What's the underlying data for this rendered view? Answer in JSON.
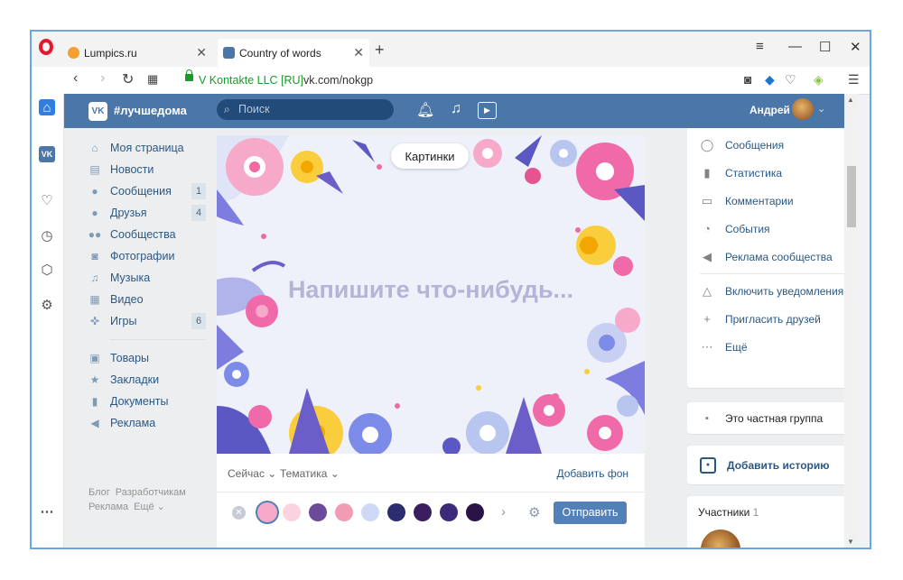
{
  "browser": {
    "tabs": [
      {
        "title": "Lumpics.ru",
        "favicon_color": "#f4a030"
      },
      {
        "title": "Country of words",
        "favicon_color": "#4a76a8"
      }
    ],
    "security_label": "V Kontakte LLC [RU]",
    "url": "vk.com/nokgp"
  },
  "vk": {
    "header": {
      "logo": "VK",
      "hashtag": "#лучшедома",
      "search_placeholder": "Поиск",
      "user_name": "Андрей"
    },
    "left_menu": [
      {
        "label": "Моя страница",
        "icon": "home-icon",
        "count": ""
      },
      {
        "label": "Новости",
        "icon": "news-icon",
        "count": ""
      },
      {
        "label": "Сообщения",
        "icon": "message-icon",
        "count": "1"
      },
      {
        "label": "Друзья",
        "icon": "user-icon",
        "count": "4"
      },
      {
        "label": "Сообщества",
        "icon": "group-icon",
        "count": ""
      },
      {
        "label": "Фотографии",
        "icon": "camera-icon",
        "count": ""
      },
      {
        "label": "Музыка",
        "icon": "music-icon",
        "count": ""
      },
      {
        "label": "Видео",
        "icon": "video-icon",
        "count": ""
      },
      {
        "label": "Игры",
        "icon": "gamepad-icon",
        "count": "6"
      }
    ],
    "left_menu_2": [
      {
        "label": "Товары",
        "icon": "bag-icon"
      },
      {
        "label": "Закладки",
        "icon": "star-icon"
      },
      {
        "label": "Документы",
        "icon": "document-icon"
      },
      {
        "label": "Реклама",
        "icon": "megaphone-icon"
      }
    ],
    "footer_links": [
      "Блог",
      "Разработчикам",
      "Реклама",
      "Ещё ⌄"
    ],
    "post": {
      "gallery_button": "Картинки",
      "placeholder": "Напишите что-нибудь...",
      "options": [
        "Сейчас ⌄",
        "Тематика ⌄"
      ],
      "add_background": "Добавить фон",
      "send": "Отправить",
      "swatch_colors": [
        "#f7a9c9",
        "#fbd3e0",
        "#6b4b9a",
        "#f29bb4",
        "#cfd8f5",
        "#2b2d6e",
        "#3a1e5f",
        "#3b2b7a",
        "#2a1446"
      ]
    },
    "right_menu": [
      {
        "label": "Сообщения",
        "icon": "message-icon"
      },
      {
        "label": "Статистика",
        "icon": "stats-icon"
      },
      {
        "label": "Комментарии",
        "icon": "comment-icon"
      },
      {
        "label": "События",
        "icon": "event-icon"
      },
      {
        "label": "Реклама сообщества",
        "icon": "megaphone-icon"
      }
    ],
    "right_menu_2": [
      {
        "label": "Включить уведомления",
        "icon": "bell-icon"
      },
      {
        "label": "Пригласить друзей",
        "icon": "add-user-icon"
      },
      {
        "label": "Ещё",
        "icon": "more-icon"
      }
    ],
    "private_group": "Это частная группа",
    "add_story": "Добавить историю",
    "members_label": "Участники",
    "members_count": "1"
  }
}
